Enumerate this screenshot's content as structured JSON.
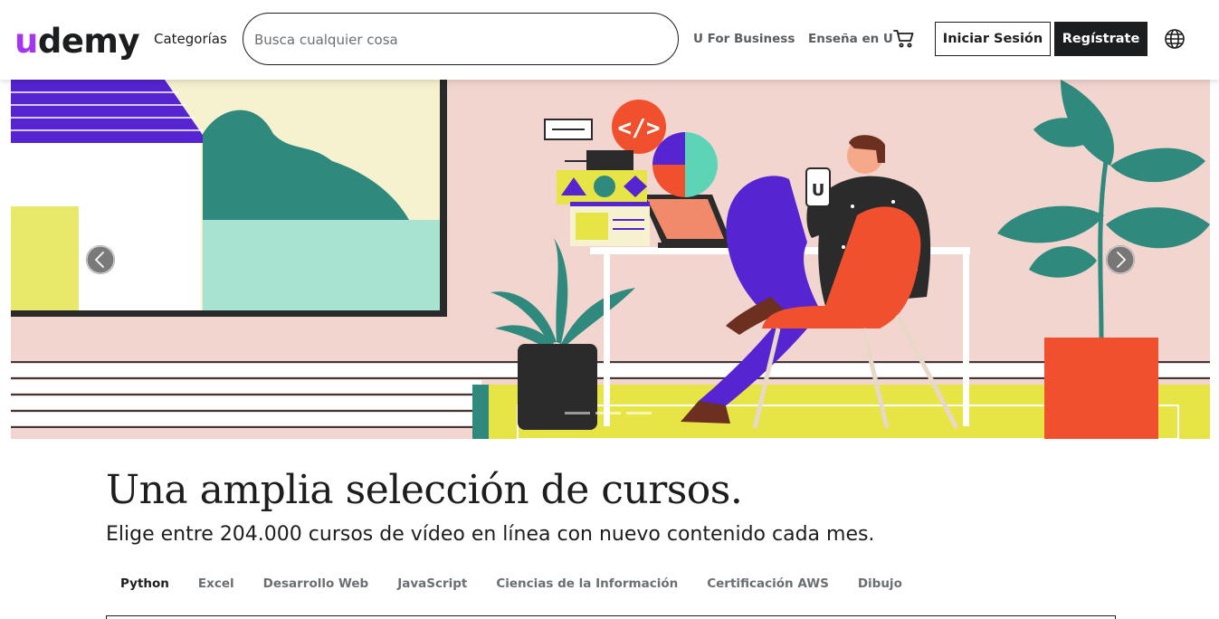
{
  "header": {
    "logo_u": "u",
    "logo_rest": "demy",
    "categories": "Categorías",
    "search_placeholder": "Busca cualquier cosa",
    "business_link": "U For Business",
    "teach_link": "Enseña en U",
    "login_button": "Iniciar Sesión",
    "signup_button": "Regístrate",
    "cart_icon": "cart-icon",
    "language_icon": "globe-icon"
  },
  "hero": {
    "phone_logo": "U",
    "slide_count": 3,
    "active_slide": 2
  },
  "main": {
    "headline": "Una amplia selección de cursos.",
    "subline": "Elige entre 204.000 cursos de vídeo en línea con nuevo contenido cada mes.",
    "tabs": [
      "Python",
      "Excel",
      "Desarrollo Web",
      "JavaScript",
      "Ciencias de la Información",
      "Certificación AWS",
      "Dibujo"
    ],
    "active_tab": "Python"
  },
  "colors": {
    "brand_purple": "#a435f0",
    "text_dark": "#1c1d1f",
    "hero_pink": "#f3d5d0",
    "hero_yellow": "#e6e545",
    "hero_teal": "#2f8a7d",
    "hero_orange": "#f0502e",
    "hero_indigo": "#5624d0"
  }
}
